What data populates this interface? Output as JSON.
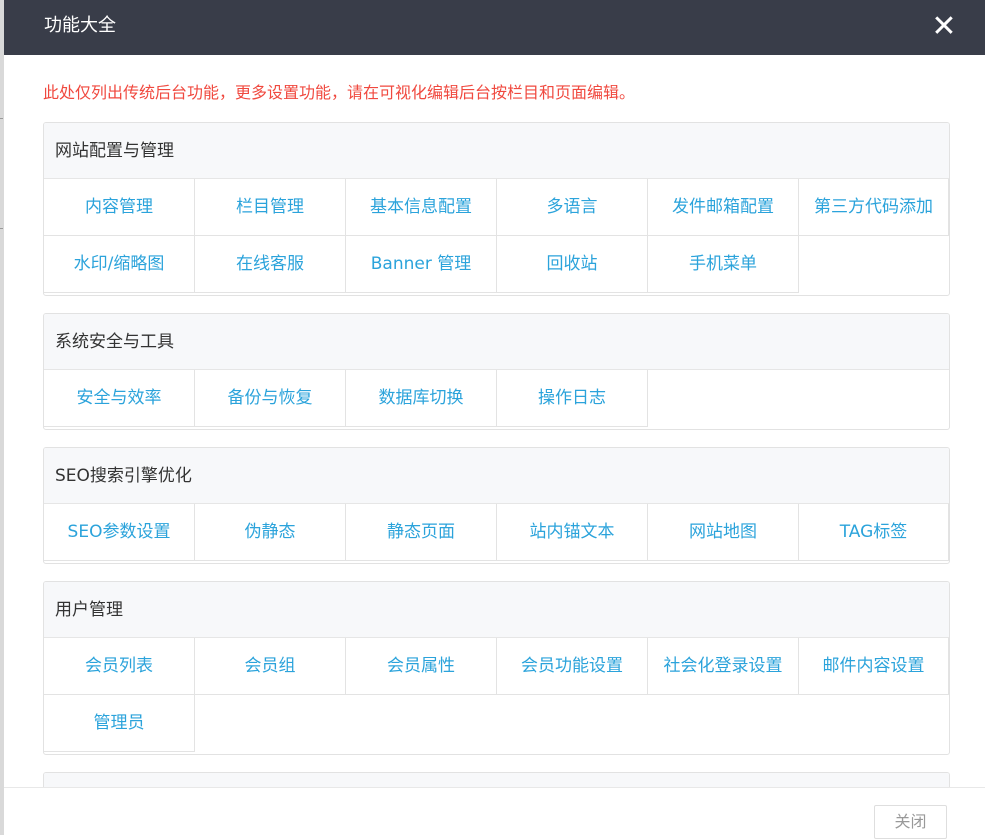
{
  "dialog": {
    "title": "功能大全",
    "close_symbol": "✕",
    "notice": "此处仅列出传统后台功能，更多设置功能，请在可视化编辑后台按栏目和页面编辑。",
    "footer_close_label": "关闭"
  },
  "colors": {
    "titlebar_bg": "#393d49",
    "link": "#2ba3db",
    "notice": "#f0493f",
    "panel_head_bg": "#f7f8fa"
  },
  "sections": [
    {
      "title": "网站配置与管理",
      "items": [
        "内容管理",
        "栏目管理",
        "基本信息配置",
        "多语言",
        "发件邮箱配置",
        "第三方代码添加",
        "水印/缩略图",
        "在线客服",
        "Banner 管理",
        "回收站",
        "手机菜单"
      ]
    },
    {
      "title": "系统安全与工具",
      "items": [
        "安全与效率",
        "备份与恢复",
        "数据库切换",
        "操作日志"
      ]
    },
    {
      "title": "SEO搜索引擎优化",
      "items": [
        "SEO参数设置",
        "伪静态",
        "静态页面",
        "站内锚文本",
        "网站地图",
        "TAG标签"
      ]
    },
    {
      "title": "用户管理",
      "items": [
        "会员列表",
        "会员组",
        "会员属性",
        "会员功能设置",
        "社会化登录设置",
        "邮件内容设置",
        "管理员"
      ]
    }
  ]
}
